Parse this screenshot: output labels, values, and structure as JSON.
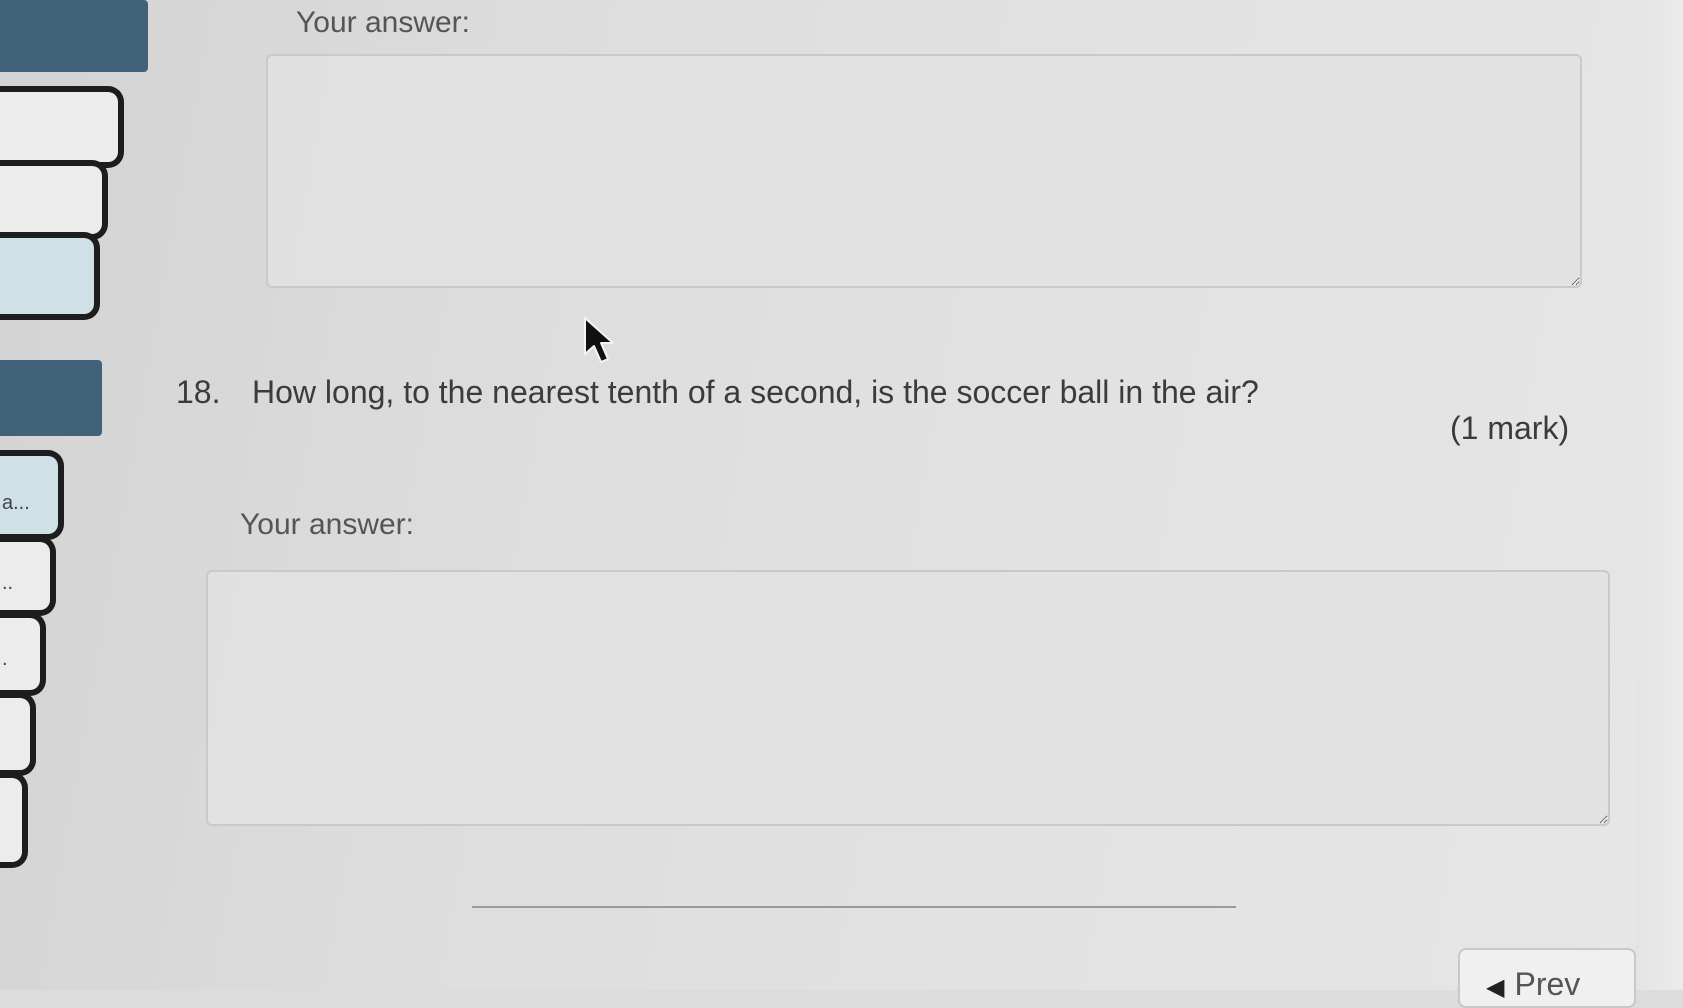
{
  "sidebar": {
    "tabs": [
      {
        "label": ""
      },
      {
        "label": ""
      },
      {
        "label": ""
      },
      {
        "label": "a..."
      },
      {
        "label": ".."
      },
      {
        "label": "."
      },
      {
        "label": ""
      },
      {
        "label": ""
      }
    ]
  },
  "previous_answer": {
    "label": "Your answer:",
    "value": ""
  },
  "question": {
    "number": "18.",
    "text": "How long, to the nearest tenth of a second, is the soccer ball in the air?",
    "marks": "(1 mark)"
  },
  "answer": {
    "label": "Your answer:",
    "value": ""
  },
  "navigation": {
    "prev_label": "Prev",
    "prev_icon": "triangle-left-icon"
  },
  "colors": {
    "sidebar_header": "#42627a",
    "active_tab": "#cfe0e6",
    "tab_border": "#1d1d1d"
  }
}
